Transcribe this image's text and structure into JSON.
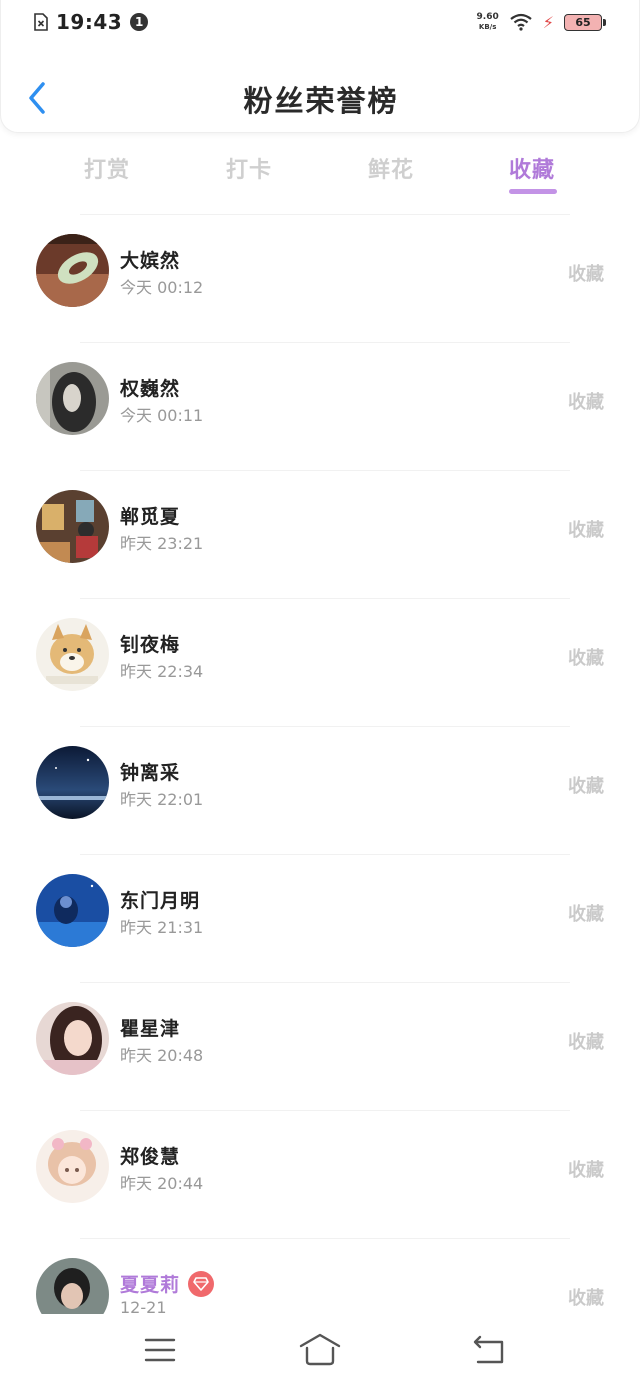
{
  "status_bar": {
    "time": "19:43",
    "notification_count": "1",
    "net_speed": "9.60",
    "net_unit": "KB/s",
    "battery": "65"
  },
  "header": {
    "title": "粉丝荣誉榜"
  },
  "tabs": [
    {
      "label": "打赏",
      "active": false
    },
    {
      "label": "打卡",
      "active": false
    },
    {
      "label": "鲜花",
      "active": false
    },
    {
      "label": "收藏",
      "active": true
    }
  ],
  "fans": [
    {
      "name": "大嫔然",
      "time": "今天 00:12",
      "action": "收藏"
    },
    {
      "name": "权巍然",
      "time": "今天 00:11",
      "action": "收藏"
    },
    {
      "name": "郸觅夏",
      "time": "昨天 23:21",
      "action": "收藏"
    },
    {
      "name": "钊夜梅",
      "time": "昨天 22:34",
      "action": "收藏"
    },
    {
      "name": "钟离采",
      "time": "昨天 22:01",
      "action": "收藏"
    },
    {
      "name": "东门月明",
      "time": "昨天 21:31",
      "action": "收藏"
    },
    {
      "name": "瞿星津",
      "time": "昨天 20:48",
      "action": "收藏"
    },
    {
      "name": "郑俊慧",
      "time": "昨天 20:44",
      "action": "收藏"
    },
    {
      "name": "夏夏莉",
      "time": "12-21",
      "action": "收藏",
      "vip": true
    }
  ],
  "colors": {
    "accent": "#b07ad9",
    "inactive_tab": "#cfcfcf",
    "vip_badge": "#f0696c",
    "back_arrow": "#2e8ff0"
  },
  "icons": {
    "back": "chevron-left-icon",
    "menu": "menu-icon",
    "home": "home-icon",
    "return": "return-icon"
  }
}
